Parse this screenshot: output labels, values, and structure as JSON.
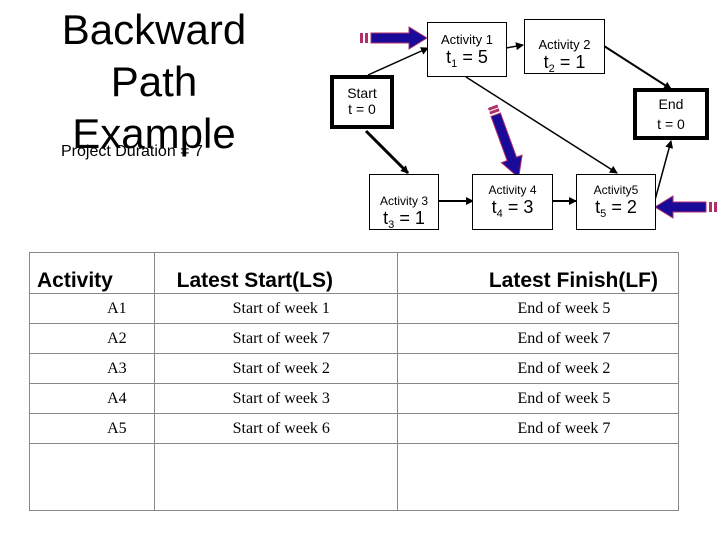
{
  "title": "Backward Path Example",
  "title_lines": [
    "Backward Path",
    "Example"
  ],
  "project_duration_label": "Project Duration = 7",
  "diagram": {
    "nodes": [
      {
        "id": "start",
        "label": "Start",
        "value_text": "t = 0"
      },
      {
        "id": "a1",
        "label": "Activity 1",
        "var": "t",
        "sub": "1",
        "value": "= 5"
      },
      {
        "id": "a2",
        "label": "Activity 2",
        "var": "t",
        "sub": "2",
        "value": "= 1"
      },
      {
        "id": "end",
        "label": "End",
        "value_text": "t = 0"
      },
      {
        "id": "a3",
        "label": "Activity 3",
        "var": "t",
        "sub": "3",
        "value": "= 1"
      },
      {
        "id": "a4",
        "label": "Activity 4",
        "var": "t",
        "sub": "4",
        "value": "= 3"
      },
      {
        "id": "a5",
        "label": "Activity5",
        "var": "t",
        "sub": "5",
        "value": "= 2"
      }
    ],
    "edges": [
      [
        "start",
        "a1"
      ],
      [
        "a1",
        "a2"
      ],
      [
        "a2",
        "end"
      ],
      [
        "start",
        "a3"
      ],
      [
        "a1",
        "a5"
      ],
      [
        "a3",
        "a4"
      ],
      [
        "a4",
        "a5"
      ],
      [
        "a5",
        "end"
      ]
    ],
    "highlight_arrow_color": "#1a0a99",
    "highlight_arrow_outline": "#b0306a"
  },
  "table": {
    "headers": [
      "Activity",
      "Latest Start(LS)",
      "Latest Finish(LF)"
    ],
    "rows": [
      [
        "A1",
        "Start of week 1",
        "End of week 5"
      ],
      [
        "A2",
        "Start of week 7",
        "End of week 7"
      ],
      [
        "A3",
        "Start of week 2",
        "End of week 2"
      ],
      [
        "A4",
        "Start of week 3",
        "End of week 5"
      ],
      [
        "A5",
        "Start of week 6",
        "End of week 7"
      ]
    ]
  }
}
